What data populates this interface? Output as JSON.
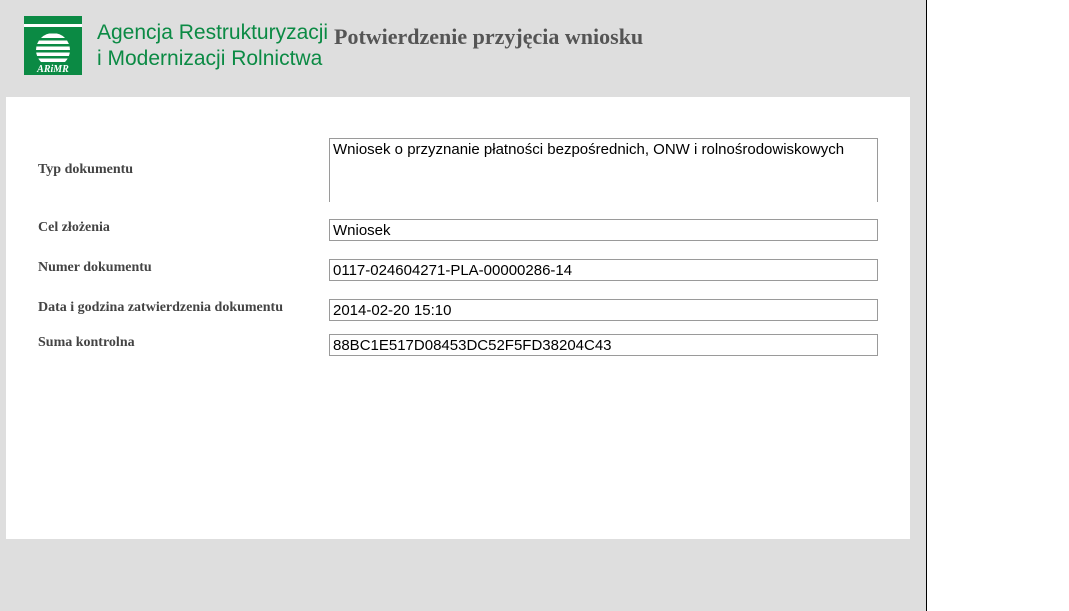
{
  "header": {
    "org_line1": "Agencja Restrukturyzacji",
    "org_line2": "i Modernizacji Rolnictwa",
    "logo_text": "ARiMR",
    "logo_icon": "arimr-logo-icon",
    "brand_color": "#0b8a44",
    "title": "Potwierdzenie przyjęcia wniosku"
  },
  "fields": {
    "typ": {
      "label": "Typ dokumentu",
      "value": "Wniosek o przyznanie płatności bezpośrednich, ONW i rolnośrodowiskowych"
    },
    "cel": {
      "label": "Cel złożenia",
      "value": "Wniosek"
    },
    "numer": {
      "label": "Numer dokumentu",
      "value": "0117-024604271-PLA-00000286-14"
    },
    "data": {
      "label": "Data i godzina zatwierdzenia dokumentu",
      "value": "2014-02-20 15:10"
    },
    "suma": {
      "label": "Suma kontrolna",
      "value": "88BC1E517D08453DC52F5FD38204C43"
    }
  }
}
